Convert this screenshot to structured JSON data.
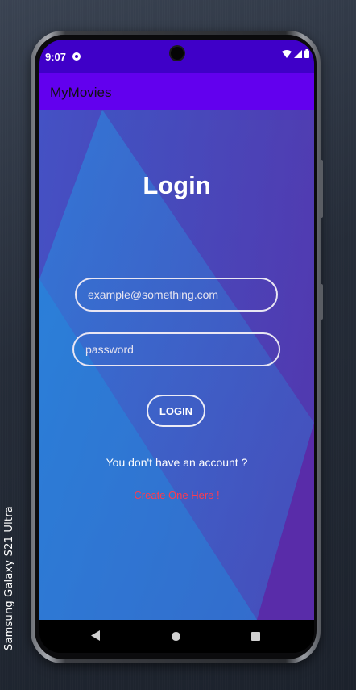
{
  "device": {
    "label": "Samsung Galaxy  S21 Ultra"
  },
  "status_bar": {
    "time": "9:07",
    "icons": [
      "app-notification-icon",
      "wifi-icon",
      "signal-icon",
      "battery-icon"
    ]
  },
  "app_bar": {
    "title": "MyMovies"
  },
  "login": {
    "title": "Login",
    "email_placeholder": "example@something.com",
    "password_placeholder": "password",
    "button_label": "LOGIN",
    "prompt": "You don't have an account ?",
    "create_link": "Create One Here !"
  },
  "nav_bar": {
    "buttons": [
      "back-icon",
      "home-icon",
      "recents-icon"
    ]
  },
  "colors": {
    "status_bar": "#3f00c8",
    "app_bar": "#6200ee",
    "gradient_start": "#2d7fd6",
    "gradient_end": "#5a2aa8",
    "link": "#ff3b4e"
  }
}
